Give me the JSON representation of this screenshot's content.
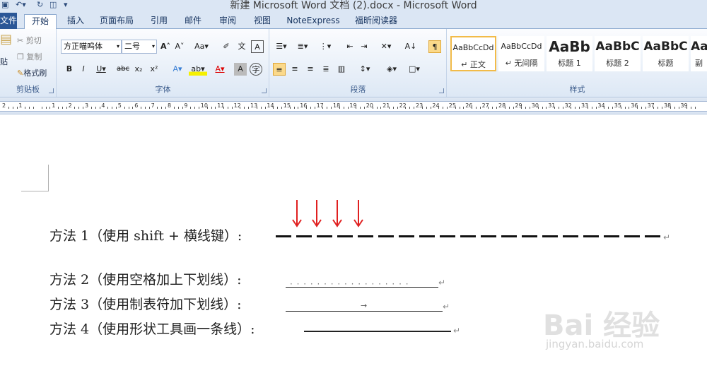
{
  "window": {
    "title": "新建 Microsoft Word 文档 (2).docx - Microsoft Word"
  },
  "tabs": {
    "file": "文件",
    "items": [
      "开始",
      "插入",
      "页面布局",
      "引用",
      "邮件",
      "审阅",
      "视图",
      "NoteExpress",
      "福昕阅读器"
    ]
  },
  "clipboard": {
    "paste": "贴",
    "cut": "剪切",
    "copy": "复制",
    "format_painter": "格式刷",
    "label": "剪贴板"
  },
  "font": {
    "name": "方正喵呜体",
    "size": "二号",
    "label": "字体"
  },
  "paragraph": {
    "label": "段落"
  },
  "styles": {
    "label": "样式",
    "tiles": [
      {
        "preview": "AaBbCcDd",
        "name": "↵ 正文"
      },
      {
        "preview": "AaBbCcDd",
        "name": "↵ 无间隔"
      },
      {
        "preview": "AaBb",
        "name": "标题 1"
      },
      {
        "preview": "AaBbC",
        "name": "标题 2"
      },
      {
        "preview": "AaBbC",
        "name": "标题"
      },
      {
        "preview": "Aa",
        "name": "副"
      }
    ]
  },
  "ruler": {
    "numbers": [
      "2",
      "1",
      "",
      "1",
      "2",
      "3",
      "4",
      "5",
      "6",
      "7",
      "8",
      "9",
      "10",
      "11",
      "12",
      "13",
      "14",
      "15",
      "16",
      "17",
      "18",
      "19",
      "20",
      "21",
      "22",
      "23",
      "24",
      "25",
      "26",
      "27",
      "28",
      "29",
      "30",
      "31",
      "32",
      "33",
      "34",
      "35",
      "36",
      "37",
      "38",
      "39"
    ]
  },
  "document": {
    "line1": "方法 1（使用 shift + 横线键）:",
    "line2": "方法 2（使用空格加上下划线）:",
    "line3": "方法 3（使用制表符加下划线）:",
    "line4": "方法 4（使用形状工具画一条线）:",
    "dots": "· · · · · · · · · · · · · · · · · ·",
    "tab_arrow": "→",
    "para_mark": "↵"
  },
  "watermark": {
    "brand": "Bai 经验",
    "url": "jingyan.baidu.com"
  },
  "colors": {
    "accent": "#2b5797",
    "arrow": "#e02020"
  }
}
